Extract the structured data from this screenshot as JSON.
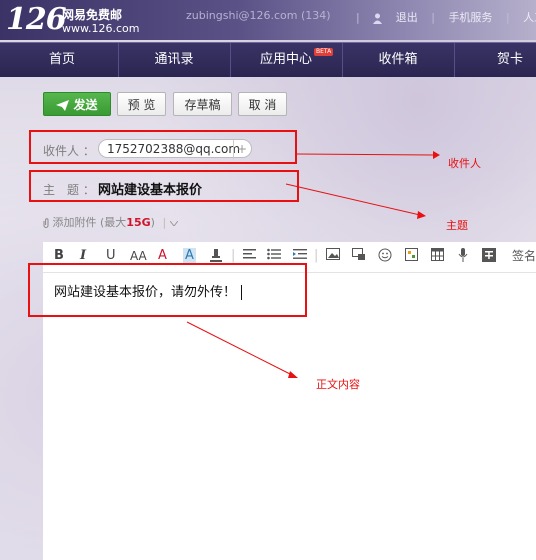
{
  "header": {
    "logo_number": "126",
    "logo_name": "网易免费邮",
    "logo_url": "www.126.com",
    "account": "zubingshi@126.com (134)",
    "links": [
      "|",
      "退出",
      "|",
      "手机服务",
      "|",
      "人工"
    ]
  },
  "nav": {
    "items": [
      "首页",
      "通讯录",
      "应用中心",
      "收件箱",
      "贺卡"
    ],
    "badge": "BETA"
  },
  "toolbar": {
    "send_label": "发送",
    "preview_label": "预 览",
    "draft_label": "存草稿",
    "cancel_label": "取 消"
  },
  "compose": {
    "recipient_label": "收件人 ：",
    "recipient_value": "1752702388@qq.com",
    "recipient_add": "+",
    "subject_label": "主　题 ：",
    "subject_value": "网站建设基本报价",
    "attach_label": "添加附件",
    "attach_limit_prefix": "(最大",
    "attach_limit_value": "15G",
    "attach_limit_suffix": ")",
    "body_text": "网站建设基本报价，请勿外传！"
  },
  "editor_toolbar": {
    "bold": "B",
    "italic": "I",
    "underline": "U",
    "font_size": "AA",
    "font_color": "A",
    "bg_color": "A",
    "signature": "签名"
  },
  "annotations": {
    "recipient": "收件人",
    "subject": "主题",
    "body": "正文内容"
  },
  "colors": {
    "annotation": "#e81010",
    "send_button": "#3a9a33",
    "nav_bg": "#2a2550"
  }
}
